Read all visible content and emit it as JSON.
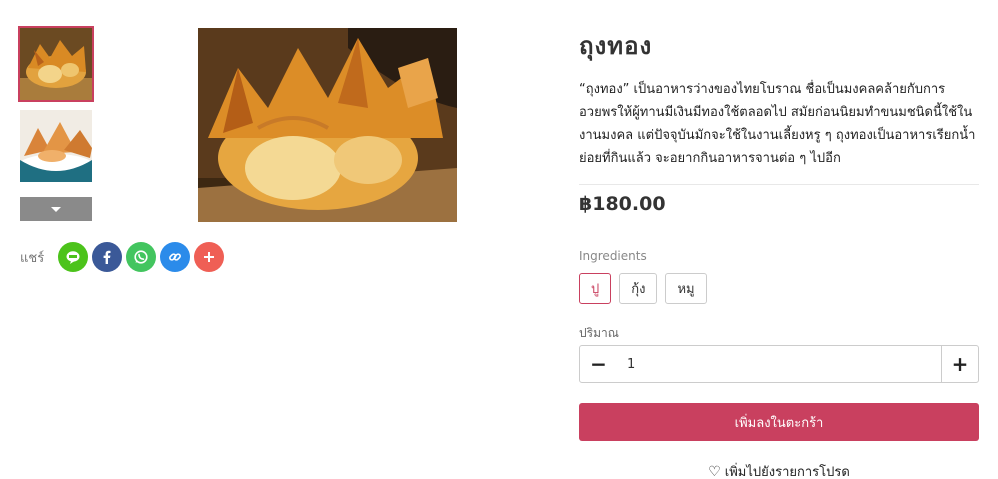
{
  "product": {
    "title": "ถุงทอง",
    "description": "“ถุงทอง” เป็นอาหารว่างของไทยโบราณ ชื่อเป็นมงคลคล้ายกับการอวยพรให้ผู้ทานมีเงินมีทองใช้ตลอดไป สมัยก่อนนิยมทำขนมชนิดนี้ใช้ในงานมงคล แต่ปัจจุบันมักจะใช้ในงานเลี้ยงหรู ๆ ถุงทองเป็นอาหารเรียกน้ำย่อยที่กินแล้ว จะอยากกินอาหารจานต่อ ๆ ไปอีก",
    "price": "฿180.00"
  },
  "gallery": {
    "thumbnails": [
      {
        "name": "fried-wonton-golden-pouch",
        "active": true
      },
      {
        "name": "fried-wonton-plate",
        "active": false
      }
    ],
    "more_icon": "chevron-down-icon"
  },
  "share": {
    "label": "แชร์",
    "buttons": [
      {
        "icon": "line-icon",
        "color": "#4cc31b"
      },
      {
        "icon": "facebook-icon",
        "color": "#3b5998"
      },
      {
        "icon": "whatsapp-icon",
        "color": "#43c55f"
      },
      {
        "icon": "link-icon",
        "color": "#2b8bea"
      },
      {
        "icon": "plus-icon",
        "color": "#ef5f55"
      }
    ]
  },
  "ingredients": {
    "label": "Ingredients",
    "options": [
      {
        "label": "ปู",
        "selected": true
      },
      {
        "label": "กุ้ง",
        "selected": false
      },
      {
        "label": "หมู",
        "selected": false
      }
    ]
  },
  "quantity": {
    "label": "ปริมาณ",
    "value": "1",
    "minus": "−",
    "plus": "+"
  },
  "actions": {
    "add_to_cart": "เพิ่มลงในตะกร้า",
    "wishlist": "เพิ่มไปยังรายการโปรด",
    "wishlist_icon": "heart-outline-icon"
  },
  "colors": {
    "accent": "#c9405f"
  }
}
